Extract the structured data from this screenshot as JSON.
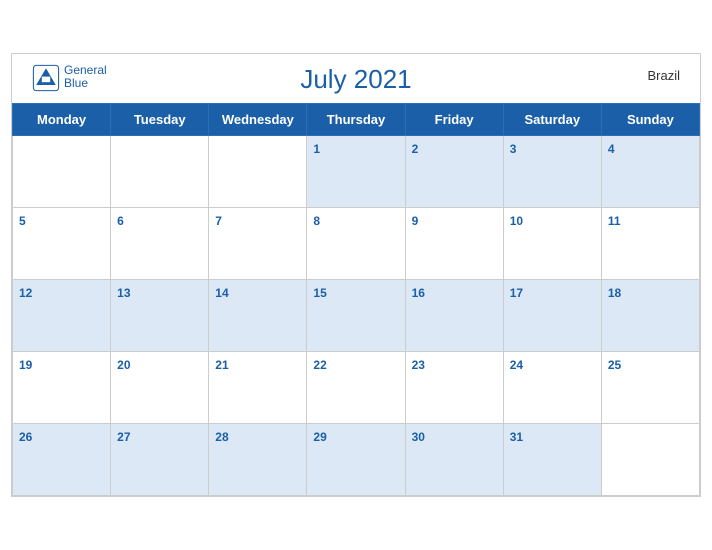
{
  "header": {
    "brand_name_line1": "General",
    "brand_name_line2": "Blue",
    "title": "July 2021",
    "country": "Brazil"
  },
  "weekdays": [
    "Monday",
    "Tuesday",
    "Wednesday",
    "Thursday",
    "Friday",
    "Saturday",
    "Sunday"
  ],
  "weeks": [
    [
      "",
      "",
      "",
      "1",
      "2",
      "3",
      "4"
    ],
    [
      "5",
      "6",
      "7",
      "8",
      "9",
      "10",
      "11"
    ],
    [
      "12",
      "13",
      "14",
      "15",
      "16",
      "17",
      "18"
    ],
    [
      "19",
      "20",
      "21",
      "22",
      "23",
      "24",
      "25"
    ],
    [
      "26",
      "27",
      "28",
      "29",
      "30",
      "31",
      ""
    ]
  ]
}
